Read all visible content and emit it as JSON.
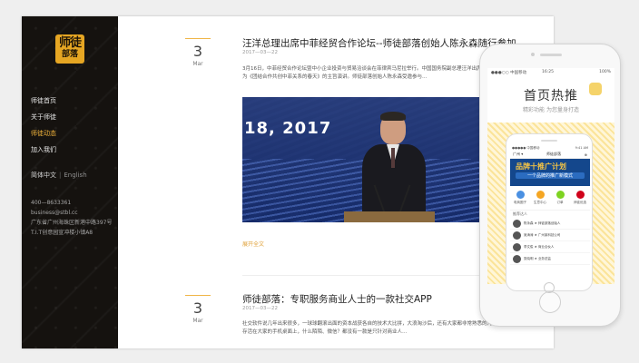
{
  "sidebar": {
    "logo_line1": "师徒",
    "logo_line2": "部落",
    "nav": [
      {
        "label": "师徒首页"
      },
      {
        "label": "关于师徒"
      },
      {
        "label": "师徒动态"
      },
      {
        "label": "加入我们"
      }
    ],
    "lang_cn": "简体中文",
    "lang_sep": "|",
    "lang_en": "English",
    "phone": "400—8633361",
    "email": "business@stbl.cc",
    "address1": "广东省广州海珠区新港中路397号",
    "address2": "T.I.T创意园宣冲楼小镇A8"
  },
  "posts": [
    {
      "day": "3",
      "month": "Mar",
      "title": "汪洋总理出席中菲经贸合作论坛--师徒部落创始人陈永森随行参加",
      "time": "2017—03—22",
      "excerpt": "3月16日，中菲经贸合作论坛暨中小企业投资与贸易洽谈会在菲律宾马尼拉举行。中国国务院副总理汪洋出席论坛并发表题为《团结合作共创中菲关系的春天》的主旨演讲。师徒部落创始人陈永森受邀参与…",
      "photo_banner": "18, 2017",
      "read_more": "展开全文"
    },
    {
      "day": "3",
      "month": "Mar",
      "title": "师徒部落：专职服务商业人士的一款社交APP",
      "time": "2017—03—22",
      "excerpt": "社交软件说几年出来很多，一球球翻滚出面的资本战获各自的技术大比拼，大浪淘沙后，还有大家都非常熟悉的几款APP还存活在大家的手机桌面上，什么陌陌、微信？都没有一款是只针对商业人…"
    }
  ],
  "phone": {
    "status_left": "●●●○○ 中国移动",
    "status_time": "16:25",
    "status_right": "100%",
    "hot_title": "首页热推",
    "hot_sub": "精彩功能 为您量身打造",
    "inner": {
      "status_left": "●●●●● 中国移动",
      "status_right": "9:41 AM",
      "nav_left": "广州 ▾",
      "nav_title": "师徒部落",
      "nav_right": "⊕",
      "banner_t1": "品牌十推广计划",
      "banner_t2": "一个品牌的推广新模式",
      "icons": [
        {
          "label": "电商圈子",
          "color": "#4a90e2"
        },
        {
          "label": "生意中心",
          "color": "#f5a623"
        },
        {
          "label": "订单",
          "color": "#7ed321"
        },
        {
          "label": "师徒优选",
          "color": "#d0021b"
        }
      ],
      "section": "推荐达人",
      "rows": [
        {
          "text": "陈永森 ★ 师徒部落创始人"
        },
        {
          "text": "吴涛涛 ★ 广州某科技公司"
        },
        {
          "text": "李文俊 ★ 商业合伙人"
        },
        {
          "text": "张晓明 ★ 业务总监"
        }
      ]
    }
  }
}
